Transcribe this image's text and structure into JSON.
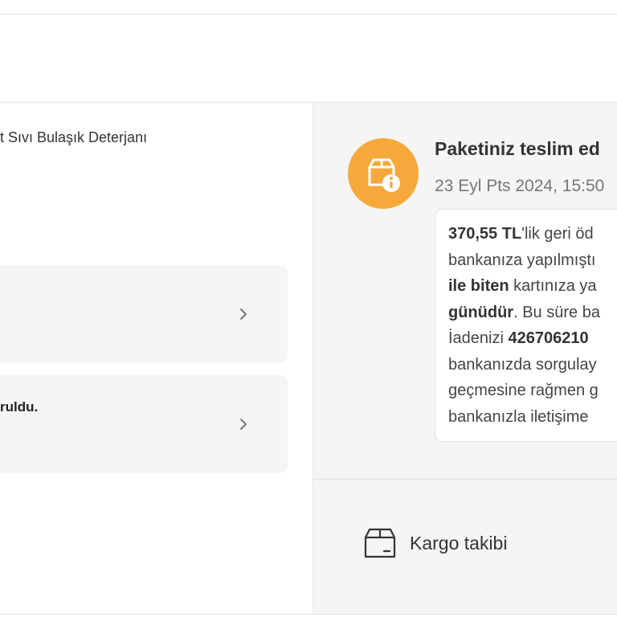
{
  "product": {
    "name": "t Sıvı Bulaşık Deterjanı"
  },
  "cards": [
    {
      "text": ""
    },
    {
      "text": "ruldu."
    }
  ],
  "status": {
    "title": "Paketiniz teslim ed",
    "date": "23 Eyl Pts 2024, 15:50",
    "icon": "package-info-icon",
    "icon_color": "#f6a93b"
  },
  "refund_message": {
    "amount": "370,55 TL",
    "part1": "'lik geri öd",
    "part2": "bankanıza yapılmıştı",
    "card_end": "ile biten",
    "part3": " kartınıza ya",
    "days": "günüdür",
    "part4": ". Bu süre ba",
    "part5": "İadenizi ",
    "ref_number": "426706210",
    "part6": "bankanızda sorgulay",
    "part7": "geçmesine rağmen g",
    "part8": "bankanızla iletişime"
  },
  "cargo": {
    "label": "Kargo takibi",
    "icon": "package-box-icon"
  }
}
